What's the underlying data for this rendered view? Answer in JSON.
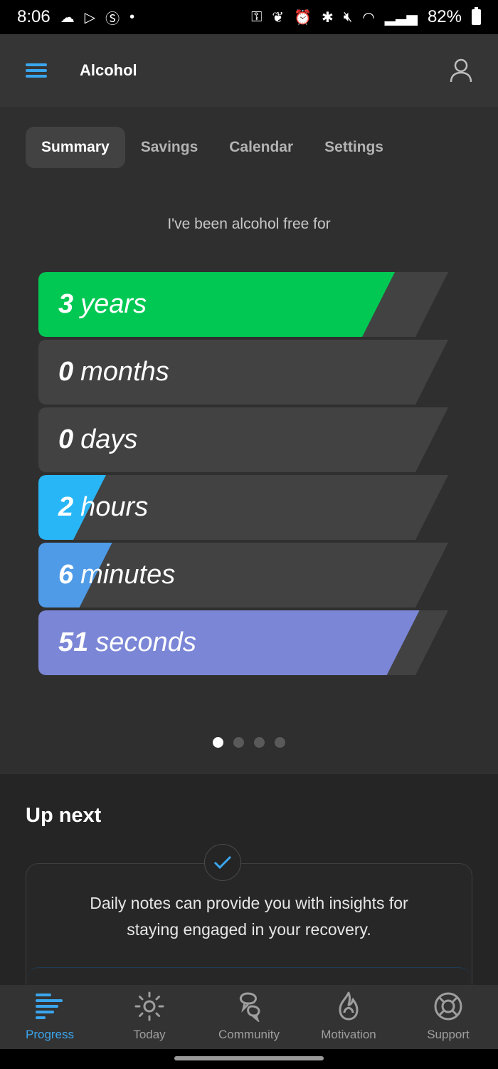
{
  "status_bar": {
    "time": "8:06",
    "battery": "82%"
  },
  "app_bar": {
    "title": "Alcohol"
  },
  "tabs": [
    {
      "label": "Summary",
      "active": true
    },
    {
      "label": "Savings",
      "active": false
    },
    {
      "label": "Calendar",
      "active": false
    },
    {
      "label": "Settings",
      "active": false
    }
  ],
  "intro": "I've been alcohol free for",
  "counters": [
    {
      "value": "3",
      "unit": "years",
      "fill_fraction": 0.79,
      "color": "#00c853"
    },
    {
      "value": "0",
      "unit": "months",
      "fill_fraction": 0.0,
      "color": "#00c853"
    },
    {
      "value": "0",
      "unit": "days",
      "fill_fraction": 0.0,
      "color": "#00c853"
    },
    {
      "value": "2",
      "unit": "hours",
      "fill_fraction": 0.085,
      "color": "#29b6f6"
    },
    {
      "value": "6",
      "unit": "minutes",
      "fill_fraction": 0.1,
      "color": "#4f9be8"
    },
    {
      "value": "51",
      "unit": "seconds",
      "fill_fraction": 0.85,
      "color": "#7b86d6"
    }
  ],
  "bar_track_color": "#424242",
  "pager": {
    "count": 4,
    "active_index": 0
  },
  "up_next": {
    "title": "Up next",
    "card_line1": "Daily notes can provide you with insights for",
    "card_line2": "staying engaged in your recovery."
  },
  "bottom_nav": [
    {
      "label": "Progress",
      "icon": "progress-icon",
      "active": true
    },
    {
      "label": "Today",
      "icon": "sun-icon",
      "active": false
    },
    {
      "label": "Community",
      "icon": "community-icon",
      "active": false
    },
    {
      "label": "Motivation",
      "icon": "flame-icon",
      "active": false
    },
    {
      "label": "Support",
      "icon": "lifebuoy-icon",
      "active": false
    }
  ],
  "accent_color": "#3aa6ee"
}
